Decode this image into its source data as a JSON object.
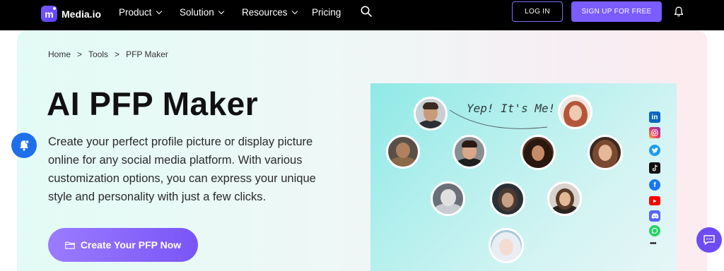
{
  "nav": {
    "brand": "Media.io",
    "items": [
      {
        "label": "Product",
        "dropdown": true
      },
      {
        "label": "Solution",
        "dropdown": true
      },
      {
        "label": "Resources",
        "dropdown": true
      },
      {
        "label": "Pricing",
        "dropdown": false
      }
    ],
    "login_label": "LOG IN",
    "signup_label": "SIGN UP FOR FREE"
  },
  "breadcrumb": [
    "Home",
    ">",
    "Tools",
    ">",
    "PFP Maker"
  ],
  "hero": {
    "title": "AI PFP Maker",
    "description": "Create your perfect profile picture or display picture online for any social media platform. With various customization options, you can express your unique style and personality with just a few clicks.",
    "cta_label": "Create Your PFP Now"
  },
  "illustration": {
    "speech_text": "Yep! It's Me!"
  },
  "social_icons": [
    "linkedin-icon",
    "instagram-icon",
    "twitter-icon",
    "tiktok-icon",
    "facebook-icon",
    "youtube-icon",
    "discord-icon",
    "whatsapp-icon",
    "more-icon"
  ],
  "more_label": "•••",
  "colors": {
    "nav_bg": "#000000",
    "accent": "#7b5cff",
    "cta_start": "#9b7bff",
    "cta_end": "#7a55f7",
    "float_bell": "#1f6feb",
    "chat_bubble": "#6d4cf6"
  }
}
